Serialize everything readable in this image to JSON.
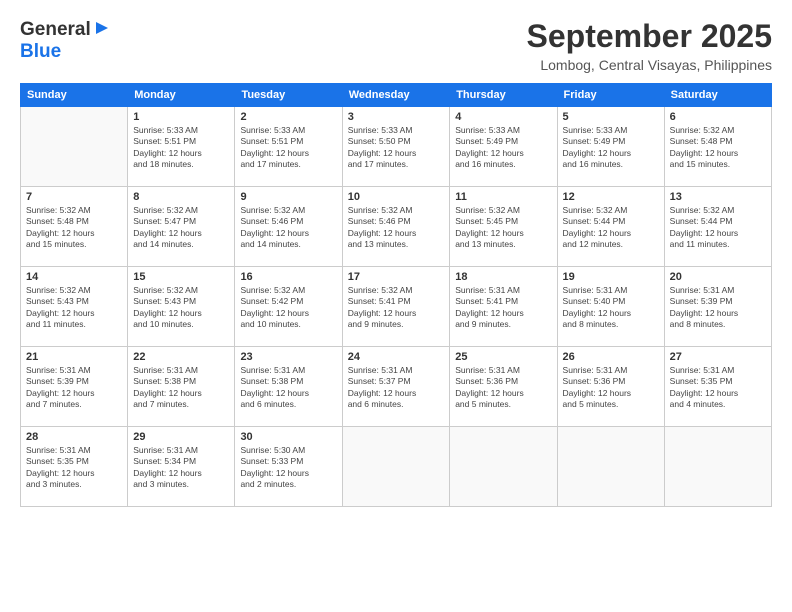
{
  "header": {
    "logo_line1": "General",
    "logo_line2": "Blue",
    "title": "September 2025",
    "subtitle": "Lombog, Central Visayas, Philippines"
  },
  "weekdays": [
    "Sunday",
    "Monday",
    "Tuesday",
    "Wednesday",
    "Thursday",
    "Friday",
    "Saturday"
  ],
  "weeks": [
    [
      {
        "day": "",
        "info": ""
      },
      {
        "day": "1",
        "info": "Sunrise: 5:33 AM\nSunset: 5:51 PM\nDaylight: 12 hours\nand 18 minutes."
      },
      {
        "day": "2",
        "info": "Sunrise: 5:33 AM\nSunset: 5:51 PM\nDaylight: 12 hours\nand 17 minutes."
      },
      {
        "day": "3",
        "info": "Sunrise: 5:33 AM\nSunset: 5:50 PM\nDaylight: 12 hours\nand 17 minutes."
      },
      {
        "day": "4",
        "info": "Sunrise: 5:33 AM\nSunset: 5:49 PM\nDaylight: 12 hours\nand 16 minutes."
      },
      {
        "day": "5",
        "info": "Sunrise: 5:33 AM\nSunset: 5:49 PM\nDaylight: 12 hours\nand 16 minutes."
      },
      {
        "day": "6",
        "info": "Sunrise: 5:32 AM\nSunset: 5:48 PM\nDaylight: 12 hours\nand 15 minutes."
      }
    ],
    [
      {
        "day": "7",
        "info": "Sunrise: 5:32 AM\nSunset: 5:48 PM\nDaylight: 12 hours\nand 15 minutes."
      },
      {
        "day": "8",
        "info": "Sunrise: 5:32 AM\nSunset: 5:47 PM\nDaylight: 12 hours\nand 14 minutes."
      },
      {
        "day": "9",
        "info": "Sunrise: 5:32 AM\nSunset: 5:46 PM\nDaylight: 12 hours\nand 14 minutes."
      },
      {
        "day": "10",
        "info": "Sunrise: 5:32 AM\nSunset: 5:46 PM\nDaylight: 12 hours\nand 13 minutes."
      },
      {
        "day": "11",
        "info": "Sunrise: 5:32 AM\nSunset: 5:45 PM\nDaylight: 12 hours\nand 13 minutes."
      },
      {
        "day": "12",
        "info": "Sunrise: 5:32 AM\nSunset: 5:44 PM\nDaylight: 12 hours\nand 12 minutes."
      },
      {
        "day": "13",
        "info": "Sunrise: 5:32 AM\nSunset: 5:44 PM\nDaylight: 12 hours\nand 11 minutes."
      }
    ],
    [
      {
        "day": "14",
        "info": "Sunrise: 5:32 AM\nSunset: 5:43 PM\nDaylight: 12 hours\nand 11 minutes."
      },
      {
        "day": "15",
        "info": "Sunrise: 5:32 AM\nSunset: 5:43 PM\nDaylight: 12 hours\nand 10 minutes."
      },
      {
        "day": "16",
        "info": "Sunrise: 5:32 AM\nSunset: 5:42 PM\nDaylight: 12 hours\nand 10 minutes."
      },
      {
        "day": "17",
        "info": "Sunrise: 5:32 AM\nSunset: 5:41 PM\nDaylight: 12 hours\nand 9 minutes."
      },
      {
        "day": "18",
        "info": "Sunrise: 5:31 AM\nSunset: 5:41 PM\nDaylight: 12 hours\nand 9 minutes."
      },
      {
        "day": "19",
        "info": "Sunrise: 5:31 AM\nSunset: 5:40 PM\nDaylight: 12 hours\nand 8 minutes."
      },
      {
        "day": "20",
        "info": "Sunrise: 5:31 AM\nSunset: 5:39 PM\nDaylight: 12 hours\nand 8 minutes."
      }
    ],
    [
      {
        "day": "21",
        "info": "Sunrise: 5:31 AM\nSunset: 5:39 PM\nDaylight: 12 hours\nand 7 minutes."
      },
      {
        "day": "22",
        "info": "Sunrise: 5:31 AM\nSunset: 5:38 PM\nDaylight: 12 hours\nand 7 minutes."
      },
      {
        "day": "23",
        "info": "Sunrise: 5:31 AM\nSunset: 5:38 PM\nDaylight: 12 hours\nand 6 minutes."
      },
      {
        "day": "24",
        "info": "Sunrise: 5:31 AM\nSunset: 5:37 PM\nDaylight: 12 hours\nand 6 minutes."
      },
      {
        "day": "25",
        "info": "Sunrise: 5:31 AM\nSunset: 5:36 PM\nDaylight: 12 hours\nand 5 minutes."
      },
      {
        "day": "26",
        "info": "Sunrise: 5:31 AM\nSunset: 5:36 PM\nDaylight: 12 hours\nand 5 minutes."
      },
      {
        "day": "27",
        "info": "Sunrise: 5:31 AM\nSunset: 5:35 PM\nDaylight: 12 hours\nand 4 minutes."
      }
    ],
    [
      {
        "day": "28",
        "info": "Sunrise: 5:31 AM\nSunset: 5:35 PM\nDaylight: 12 hours\nand 3 minutes."
      },
      {
        "day": "29",
        "info": "Sunrise: 5:31 AM\nSunset: 5:34 PM\nDaylight: 12 hours\nand 3 minutes."
      },
      {
        "day": "30",
        "info": "Sunrise: 5:30 AM\nSunset: 5:33 PM\nDaylight: 12 hours\nand 2 minutes."
      },
      {
        "day": "",
        "info": ""
      },
      {
        "day": "",
        "info": ""
      },
      {
        "day": "",
        "info": ""
      },
      {
        "day": "",
        "info": ""
      }
    ]
  ]
}
